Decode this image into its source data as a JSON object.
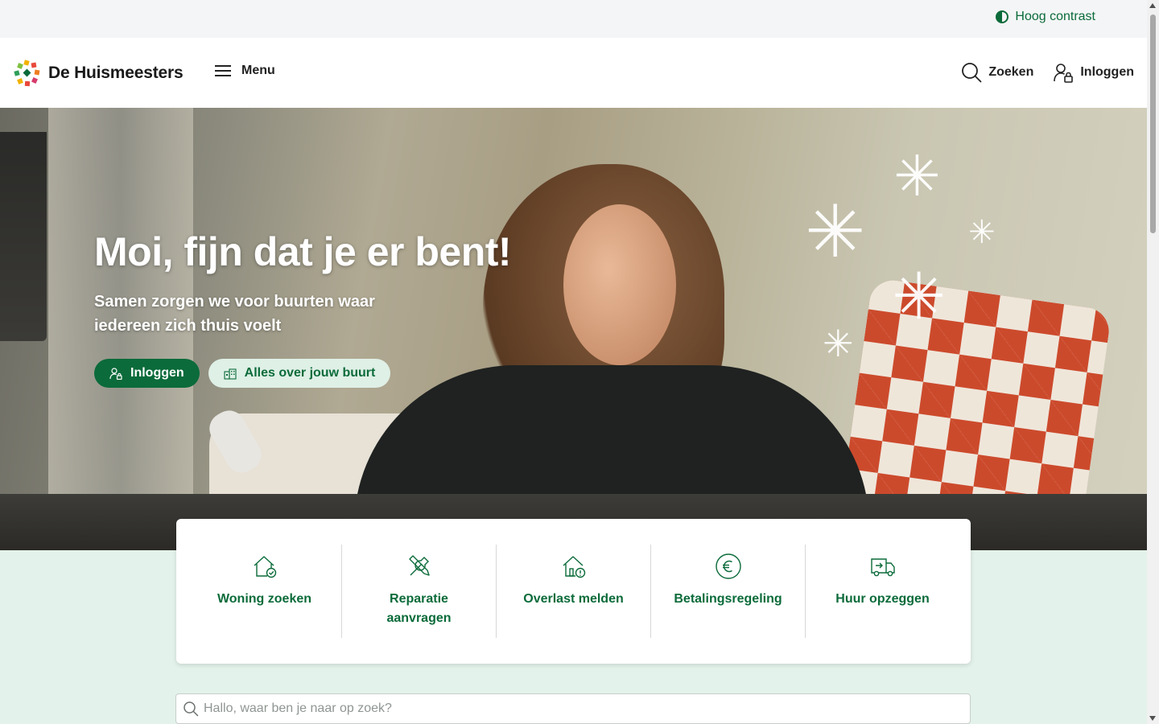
{
  "utility": {
    "contrast_label": "Hoog contrast"
  },
  "header": {
    "logo_text": "De Huismeesters",
    "menu_label": "Menu",
    "search_label": "Zoeken",
    "login_label": "Inloggen"
  },
  "hero": {
    "title": "Moi, fijn dat je er bent!",
    "subtitle": "Samen zorgen we voor buurten waar iedereen zich thuis voelt",
    "primary_button": "Inloggen",
    "secondary_button": "Alles over jouw buurt"
  },
  "quick_links": [
    {
      "label": "Woning zoeken",
      "icon": "house-check-icon"
    },
    {
      "label": "Reparatie aanvragen",
      "icon": "tools-icon"
    },
    {
      "label": "Overlast melden",
      "icon": "house-alert-icon"
    },
    {
      "label": "Betalingsregeling",
      "icon": "euro-icon"
    },
    {
      "label": "Huur opzeggen",
      "icon": "moving-truck-icon"
    }
  ],
  "search": {
    "placeholder": "Hallo, waar ben je naar op zoek?",
    "value": ""
  },
  "colors": {
    "brand_green": "#0b6b3a",
    "mint": "#e3f2ea",
    "utility_bg": "#f4f5f6"
  }
}
